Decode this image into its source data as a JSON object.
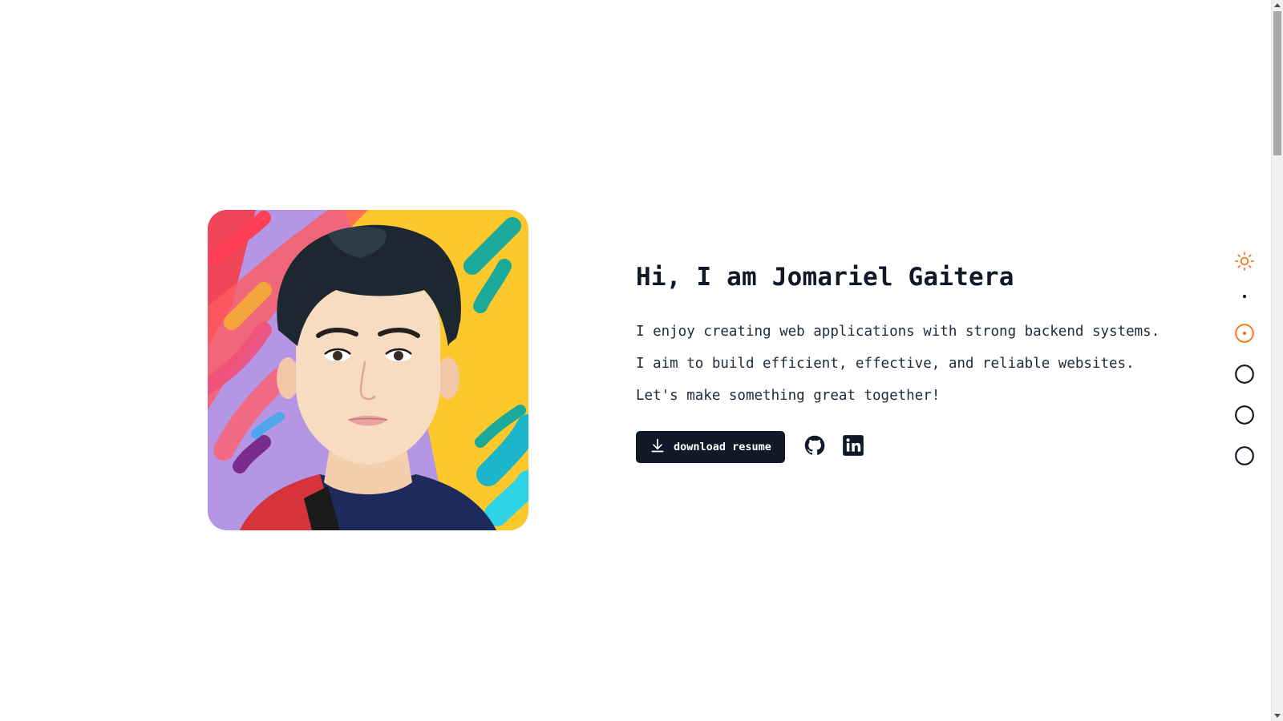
{
  "hero": {
    "heading": "Hi, I am Jomariel Gaitera",
    "intro": "I enjoy creating web applications with strong backend systems. I aim to build efficient, effective, and reliable websites. Let's make something great together!",
    "resume_button_label": "download resume"
  },
  "icons": {
    "resume": "download-icon",
    "github": "github-icon",
    "linkedin": "linkedin-icon",
    "theme": "sun-icon"
  },
  "colors": {
    "accent": "#f97316",
    "text": "#111827",
    "button_bg": "#111827",
    "nav_inactive": "#111827"
  },
  "side_nav": {
    "items": [
      {
        "name": "theme-toggle",
        "icon": "sun-icon",
        "state": "accent"
      },
      {
        "name": "nav-dot-small",
        "icon": "dot-icon",
        "state": "inactive"
      },
      {
        "name": "nav-section-1",
        "icon": "circle-icon",
        "state": "active"
      },
      {
        "name": "nav-section-2",
        "icon": "circle-icon",
        "state": "inactive"
      },
      {
        "name": "nav-section-3",
        "icon": "circle-icon",
        "state": "inactive"
      },
      {
        "name": "nav-section-4",
        "icon": "circle-icon",
        "state": "inactive"
      }
    ]
  }
}
